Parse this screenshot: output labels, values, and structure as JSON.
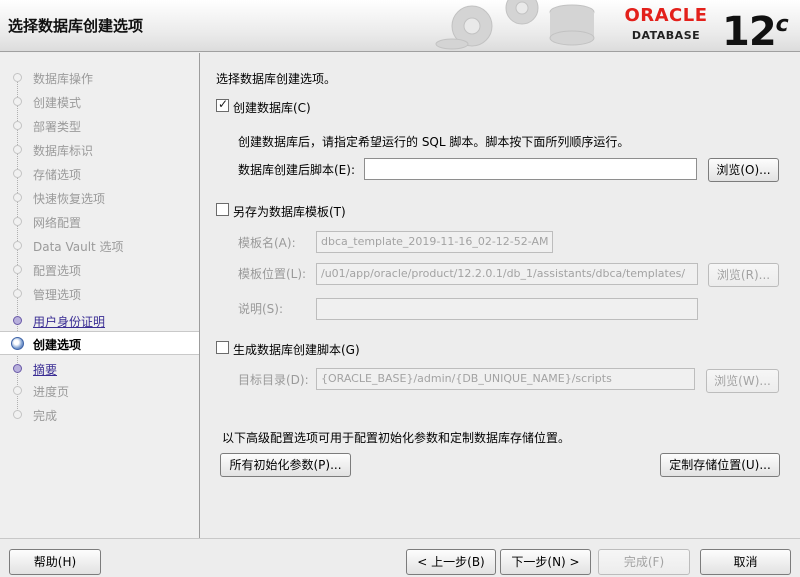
{
  "header": {
    "title": "选择数据库创建选项",
    "logo_word": "ORACLE",
    "logo_sub": "DATABASE",
    "version": "12",
    "version_suffix": "c"
  },
  "sidebar": {
    "items": [
      {
        "label": "数据库操作",
        "state": "done"
      },
      {
        "label": "创建模式",
        "state": "done"
      },
      {
        "label": "部署类型",
        "state": "done"
      },
      {
        "label": "数据库标识",
        "state": "done"
      },
      {
        "label": "存储选项",
        "state": "done"
      },
      {
        "label": "快速恢复选项",
        "state": "done"
      },
      {
        "label": "网络配置",
        "state": "done"
      },
      {
        "label": "Data Vault 选项",
        "state": "done"
      },
      {
        "label": "配置选项",
        "state": "done"
      },
      {
        "label": "管理选项",
        "state": "done"
      },
      {
        "label": "用户身份证明",
        "state": "link"
      },
      {
        "label": "创建选项",
        "state": "current"
      },
      {
        "label": "摘要",
        "state": "link"
      },
      {
        "label": "进度页",
        "state": "pending"
      },
      {
        "label": "完成",
        "state": "pending"
      }
    ]
  },
  "main": {
    "intro": "选择数据库创建选项。",
    "create_db": {
      "label": "创建数据库(C)",
      "checked": true,
      "description": "创建数据库后，请指定希望运行的 SQL 脚本。脚本按下面所列顺序运行。",
      "script_label": "数据库创建后脚本(E):",
      "script_value": "",
      "browse_label": "浏览(O)..."
    },
    "save_template": {
      "label": "另存为数据库模板(T)",
      "checked": false,
      "name_label": "模板名(A):",
      "name_value": "dbca_template_2019-11-16_02-12-52-AM",
      "location_label": "模板位置(L):",
      "location_value": "/u01/app/oracle/product/12.2.0.1/db_1/assistants/dbca/templates/",
      "browse_label": "浏览(R)...",
      "desc_label": "说明(S):",
      "desc_value": ""
    },
    "gen_scripts": {
      "label": "生成数据库创建脚本(G)",
      "checked": false,
      "dest_label": "目标目录(D):",
      "dest_value": "{ORACLE_BASE}/admin/{DB_UNIQUE_NAME}/scripts",
      "browse_label": "浏览(W)..."
    },
    "advanced_text": "以下高级配置选项可用于配置初始化参数和定制数据库存储位置。",
    "init_params_button": "所有初始化参数(P)...",
    "storage_button": "定制存储位置(U)..."
  },
  "footer": {
    "help": "帮助(H)",
    "back": "< 上一步(B)",
    "next": "下一步(N) >",
    "finish": "完成(F)",
    "cancel": "取消"
  },
  "colors": {
    "oracle_red": "#e3201b",
    "link_purple": "#3a2d94",
    "disabled_gray": "#9a9a9a"
  }
}
